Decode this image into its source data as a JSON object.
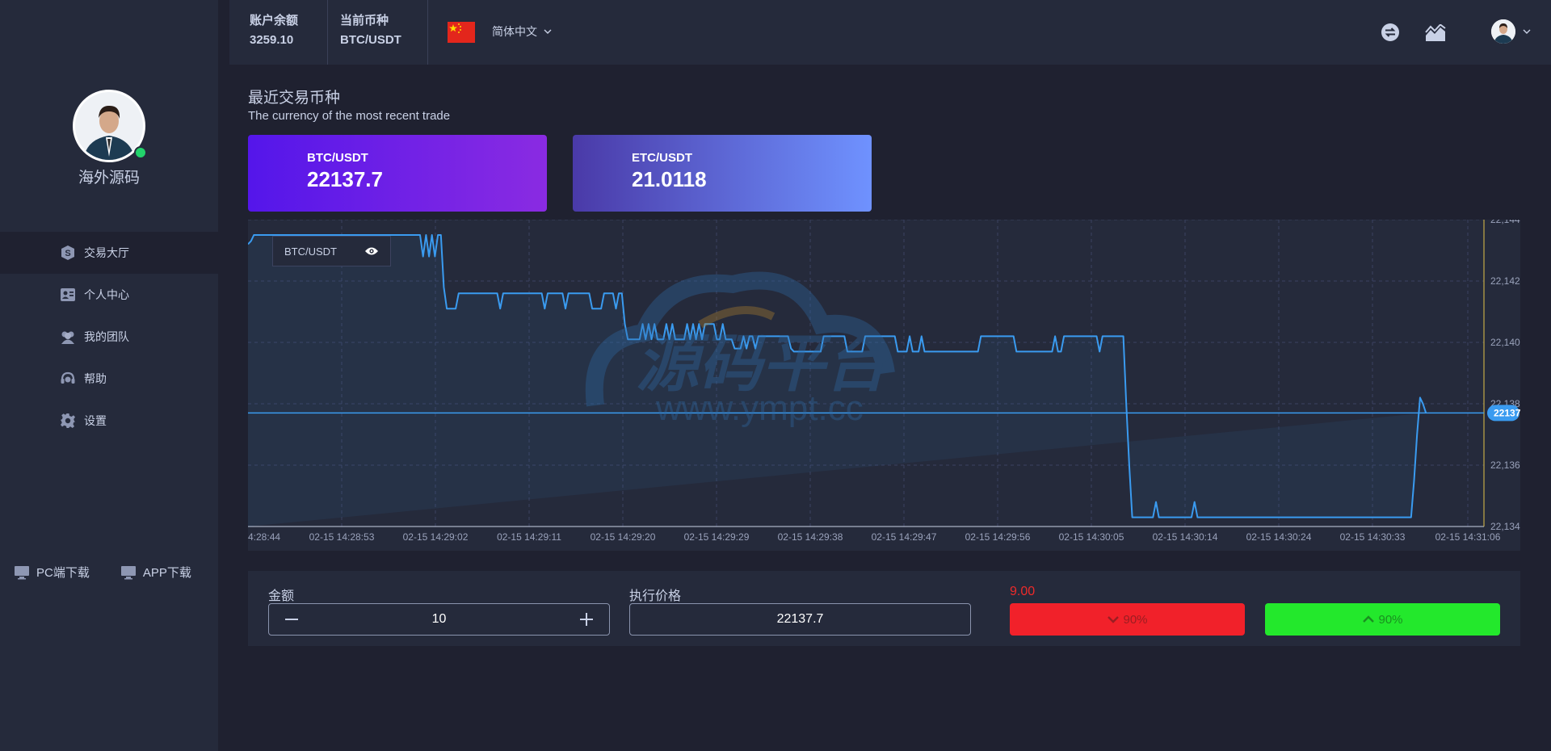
{
  "sidebar": {
    "username": "海外源码",
    "nav": [
      {
        "label": "交易大厅",
        "icon": "dollar-shield-icon"
      },
      {
        "label": "个人中心",
        "icon": "id-card-icon"
      },
      {
        "label": "我的团队",
        "icon": "team-icon"
      },
      {
        "label": "帮助",
        "icon": "headset-icon"
      },
      {
        "label": "设置",
        "icon": "gear-icon"
      }
    ],
    "downloads": {
      "pc": "PC端下载",
      "app": "APP下载"
    }
  },
  "topbar": {
    "balance_label": "账户余额",
    "balance_value": "3259.10",
    "currency_label": "当前币种",
    "currency_value": "BTC/USDT",
    "language": "简体中文"
  },
  "recent": {
    "title": "最近交易币种",
    "subtitle": "The currency of the most recent trade",
    "cards": [
      {
        "symbol": "BTC/USDT",
        "price": "22137.7"
      },
      {
        "symbol": "ETC/USDT",
        "price": "21.0118"
      }
    ]
  },
  "chart_legend": "BTC/USDT",
  "chart_data": {
    "type": "line",
    "series": [
      {
        "name": "BTC/USDT",
        "x_index": [
          0,
          3,
          6,
          9,
          12,
          15,
          18,
          21,
          24,
          27,
          30,
          33,
          36,
          39,
          42,
          45,
          48,
          51,
          54,
          57,
          60,
          63,
          66,
          69,
          72,
          75,
          78,
          81,
          84,
          87,
          90,
          93,
          96,
          99,
          102,
          105,
          108,
          111,
          114,
          117,
          120,
          123,
          126,
          129,
          132,
          135,
          138,
          141,
          144,
          147,
          150,
          153,
          156,
          159,
          162,
          165,
          168,
          171,
          174,
          177,
          180,
          183,
          186,
          189,
          192,
          195,
          198,
          201,
          204,
          207,
          210,
          213,
          216,
          219,
          222,
          225,
          228,
          231,
          234,
          237,
          240,
          243,
          246,
          249,
          252,
          255,
          258,
          261,
          264,
          267,
          270,
          273,
          276,
          279,
          282,
          285,
          288,
          291,
          294,
          297,
          300,
          303,
          306,
          309,
          312,
          315,
          318,
          321,
          324,
          327,
          330,
          333,
          336,
          339,
          342,
          345,
          348,
          351,
          354,
          357,
          360,
          363,
          366,
          369,
          372,
          375,
          378,
          381,
          384,
          387,
          390,
          393,
          396,
          399,
          402,
          405,
          408,
          411,
          414,
          417,
          420,
          423,
          426,
          429,
          432,
          435,
          438,
          441,
          444,
          447,
          450,
          453,
          456,
          459,
          462,
          465,
          468,
          471,
          474,
          477,
          480,
          483,
          486,
          489,
          492,
          495,
          498,
          501,
          504,
          507,
          510,
          513,
          516,
          519,
          522,
          525,
          528,
          531,
          534,
          537,
          540,
          543,
          546,
          549,
          552,
          555,
          558,
          561,
          564,
          567,
          570,
          573,
          576,
          579,
          582,
          585,
          588,
          591,
          594,
          597,
          600,
          603,
          606,
          609,
          612,
          615,
          618,
          621,
          624,
          627,
          630,
          633,
          636,
          639,
          642,
          645,
          648,
          651,
          654,
          657,
          660,
          663,
          666,
          669,
          672,
          675,
          678,
          681,
          684,
          687,
          690,
          693,
          696,
          699,
          702,
          705,
          708,
          711,
          714,
          717,
          720,
          723,
          726,
          729,
          732,
          735,
          738,
          741,
          744,
          747,
          750,
          753,
          756,
          759,
          762,
          765,
          768,
          771,
          774,
          777,
          780,
          783,
          786,
          789,
          792,
          795,
          798,
          801,
          804,
          807,
          810,
          813,
          816,
          819,
          822,
          825,
          828,
          831,
          834,
          837,
          840,
          843,
          846,
          849,
          852,
          855,
          858,
          861,
          864,
          867,
          870,
          873,
          876,
          879,
          882,
          885,
          888,
          891,
          894,
          897,
          900,
          903,
          906,
          909,
          912,
          915,
          918,
          921,
          924,
          927,
          930,
          933,
          936,
          939,
          942,
          945,
          948,
          951,
          954,
          957,
          960,
          963,
          966,
          969,
          972,
          975,
          978,
          981,
          984,
          987,
          990,
          993,
          996,
          999,
          1002,
          1005,
          1008,
          1011,
          1014,
          1017,
          1020,
          1023,
          1026,
          1029,
          1032,
          1035,
          1038,
          1041,
          1044,
          1047,
          1050,
          1053,
          1056,
          1059,
          1062,
          1065,
          1068,
          1071,
          1074,
          1077,
          1080,
          1083,
          1086,
          1089,
          1092,
          1095,
          1098,
          1101,
          1104,
          1107,
          1110,
          1113,
          1116,
          1119,
          1122,
          1125,
          1128,
          1131,
          1134,
          1137,
          1140,
          1143,
          1146,
          1149,
          1152,
          1155,
          1158,
          1161,
          1164,
          1167,
          1170,
          1173,
          1176,
          1179,
          1182,
          1185,
          1188,
          1191,
          1194,
          1197,
          1200,
          1203,
          1206,
          1209,
          1212,
          1215,
          1218,
          1221,
          1224,
          1227,
          1230,
          1233,
          1236,
          1239,
          1242,
          1245,
          1248
        ],
        "values": [
          22143.2,
          22143.3,
          22143.5,
          22143.5,
          22143.5,
          22143.5,
          22143.5,
          22143.5,
          22143.5,
          22143.5,
          22143.5,
          22143.5,
          22143.5,
          22143.5,
          22143.5,
          22143.5,
          22143.5,
          22143.5,
          22143.5,
          22143.5,
          22143.5,
          22143.5,
          22143.5,
          22143.5,
          22143.5,
          22143.5,
          22143.5,
          22143.5,
          22143.5,
          22143.5,
          22143.5,
          22143.5,
          22143.5,
          22143.5,
          22143.5,
          22143.5,
          22143.5,
          22143.5,
          22143.5,
          22143.5,
          22143.5,
          22143.5,
          22143.5,
          22143.5,
          22143.5,
          22143.5,
          22143.5,
          22143.5,
          22143.5,
          22143.5,
          22143.5,
          22143.5,
          22143.5,
          22143.5,
          22143.5,
          22143.5,
          22143.5,
          22143.5,
          22143.5,
          22142.8,
          22143.5,
          22142.8,
          22143.5,
          22142.8,
          22143.5,
          22143.5,
          22141.8,
          22141.1,
          22141.1,
          22141.1,
          22141.1,
          22141.6,
          22141.6,
          22141.6,
          22141.6,
          22141.6,
          22141.6,
          22141.6,
          22141.6,
          22141.6,
          22141.6,
          22141.6,
          22141.6,
          22141.6,
          22141.6,
          22141.1,
          22141.6,
          22141.6,
          22141.6,
          22141.6,
          22141.6,
          22141.6,
          22141.6,
          22141.6,
          22141.6,
          22141.6,
          22141.6,
          22141.6,
          22141.6,
          22141.6,
          22141.1,
          22141.6,
          22141.6,
          22141.6,
          22141.6,
          22141.6,
          22141.6,
          22141.1,
          22141.6,
          22141.6,
          22141.6,
          22141.6,
          22141.6,
          22141.6,
          22141.6,
          22141.6,
          22141.1,
          22141.1,
          22141.1,
          22141.1,
          22141.6,
          22141.6,
          22141.6,
          22141.6,
          22141.1,
          22141.6,
          22141.6,
          22140.6,
          22140.1,
          22140.1,
          22140.1,
          22140.1,
          22140.1,
          22140.6,
          22140.1,
          22140.6,
          22140.1,
          22140.6,
          22140.1,
          22140.1,
          22140.1,
          22140.6,
          22140.1,
          22140.6,
          22140.1,
          22140.1,
          22140.1,
          22140.1,
          22140.6,
          22140.1,
          22140.6,
          22140.1,
          22140.6,
          22140.1,
          22140.6,
          22140.6,
          22140.6,
          22140.6,
          22140.1,
          22140.1,
          22140.6,
          22140.1,
          22140.1,
          22140.1,
          22139.8,
          22139.8,
          22139.8,
          22140.2,
          22139.8,
          22140.2,
          22140.2,
          22139.8,
          22140.2,
          22140.2,
          22140.2,
          22140.2,
          22140.2,
          22140.2,
          22140.2,
          22140.2,
          22140.2,
          22140.2,
          22140.2,
          22139.8,
          22139.7,
          22139.7,
          22139.7,
          22139.7,
          22139.7,
          22139.7,
          22139.7,
          22139.7,
          22139.7,
          22139.7,
          22140.2,
          22140.2,
          22140.2,
          22140.2,
          22140.2,
          22140.2,
          22140.2,
          22140.2,
          22139.7,
          22139.7,
          22139.7,
          22139.7,
          22139.7,
          22139.7,
          22140.2,
          22140.2,
          22140.2,
          22140.2,
          22140.2,
          22140.2,
          22140.2,
          22140.2,
          22140.2,
          22140.2,
          22140.2,
          22139.7,
          22139.7,
          22139.7,
          22139.7,
          22140.2,
          22139.7,
          22139.7,
          22139.7,
          22140.2,
          22139.7,
          22139.7,
          22139.7,
          22139.7,
          22139.7,
          22139.7,
          22139.7,
          22139.7,
          22139.7,
          22139.7,
          22139.7,
          22139.7,
          22139.7,
          22139.7,
          22139.7,
          22139.7,
          22139.7,
          22139.7,
          22139.7,
          22140.2,
          22140.2,
          22140.2,
          22140.2,
          22140.2,
          22140.2,
          22140.2,
          22140.2,
          22140.2,
          22140.2,
          22140.2,
          22140.2,
          22139.7,
          22139.7,
          22139.7,
          22139.7,
          22139.7,
          22139.7,
          22139.7,
          22139.7,
          22139.7,
          22139.7,
          22139.7,
          22139.7,
          22139.7,
          22140.2,
          22139.7,
          22139.7,
          22140.2,
          22140.2,
          22140.2,
          22140.2,
          22140.2,
          22140.2,
          22140.2,
          22140.2,
          22140.2,
          22140.2,
          22140.2,
          22140.2,
          22139.7,
          22140.2,
          22140.2,
          22140.2,
          22140.2,
          22140.2,
          22140.2,
          22140.2,
          22140.2,
          22138.0,
          22136.0,
          22134.3,
          22134.3,
          22134.3,
          22134.3,
          22134.3,
          22134.3,
          22134.3,
          22134.3,
          22134.8,
          22134.3,
          22134.3,
          22134.3,
          22134.3,
          22134.3,
          22134.3,
          22134.3,
          22134.3,
          22134.3,
          22134.3,
          22134.3,
          22134.3,
          22134.8,
          22134.3,
          22134.3,
          22134.3,
          22134.3,
          22134.3,
          22134.3,
          22134.3,
          22134.3,
          22134.3,
          22134.3,
          22134.3,
          22134.3,
          22134.3,
          22134.3,
          22134.3,
          22134.3,
          22134.3,
          22134.3,
          22134.3,
          22134.3,
          22134.3,
          22134.3,
          22134.3,
          22134.3,
          22134.3,
          22134.3,
          22134.3,
          22134.3,
          22134.3,
          22134.3,
          22134.3,
          22134.3,
          22134.3,
          22134.3,
          22134.3,
          22134.3,
          22134.3,
          22134.3,
          22134.3,
          22134.3,
          22134.3,
          22134.3,
          22134.3,
          22134.3,
          22134.3,
          22134.3,
          22134.3,
          22134.3,
          22134.3,
          22134.3,
          22134.3,
          22134.3,
          22134.3,
          22134.3,
          22134.3,
          22134.3,
          22134.3,
          22134.3,
          22134.3,
          22134.3,
          22134.3,
          22134.3,
          22134.3,
          22134.3,
          22134.3,
          22134.3,
          22134.3,
          22134.3,
          22134.3,
          22134.3,
          22134.3,
          22134.3,
          22134.3,
          22135.5,
          22137.0,
          22138.2,
          22138.0,
          22137.7
        ]
      }
    ],
    "x_tick_labels": [
      "4:28:44",
      "02-15 14:28:53",
      "02-15 14:29:02",
      "02-15 14:29:11",
      "02-15 14:29:20",
      "02-15 14:29:29",
      "02-15 14:29:38",
      "02-15 14:29:47",
      "02-15 14:29:56",
      "02-15 14:30:05",
      "02-15 14:30:14",
      "02-15 14:30:24",
      "02-15 14:30:33",
      "02-15 14:31:06"
    ],
    "y_tick_labels": [
      "22,144",
      "22,142",
      "22,140",
      "22,138",
      "22,136",
      "22,134"
    ],
    "ylim": [
      22134,
      22144
    ],
    "current_price_label": "22137",
    "current_price": 22137.7,
    "grid": true,
    "watermark": "源码平台",
    "watermark_url": "www.ympt.cc"
  },
  "trade": {
    "amount_label": "金额",
    "amount_value": "10",
    "exec_price_label": "执行价格",
    "exec_price_value": "22137.7",
    "fee": "9.00",
    "down_pct": "90%",
    "up_pct": "90%"
  },
  "colors": {
    "line": "#3a9bf0",
    "down": "#f1212a",
    "up": "#23e82c"
  }
}
